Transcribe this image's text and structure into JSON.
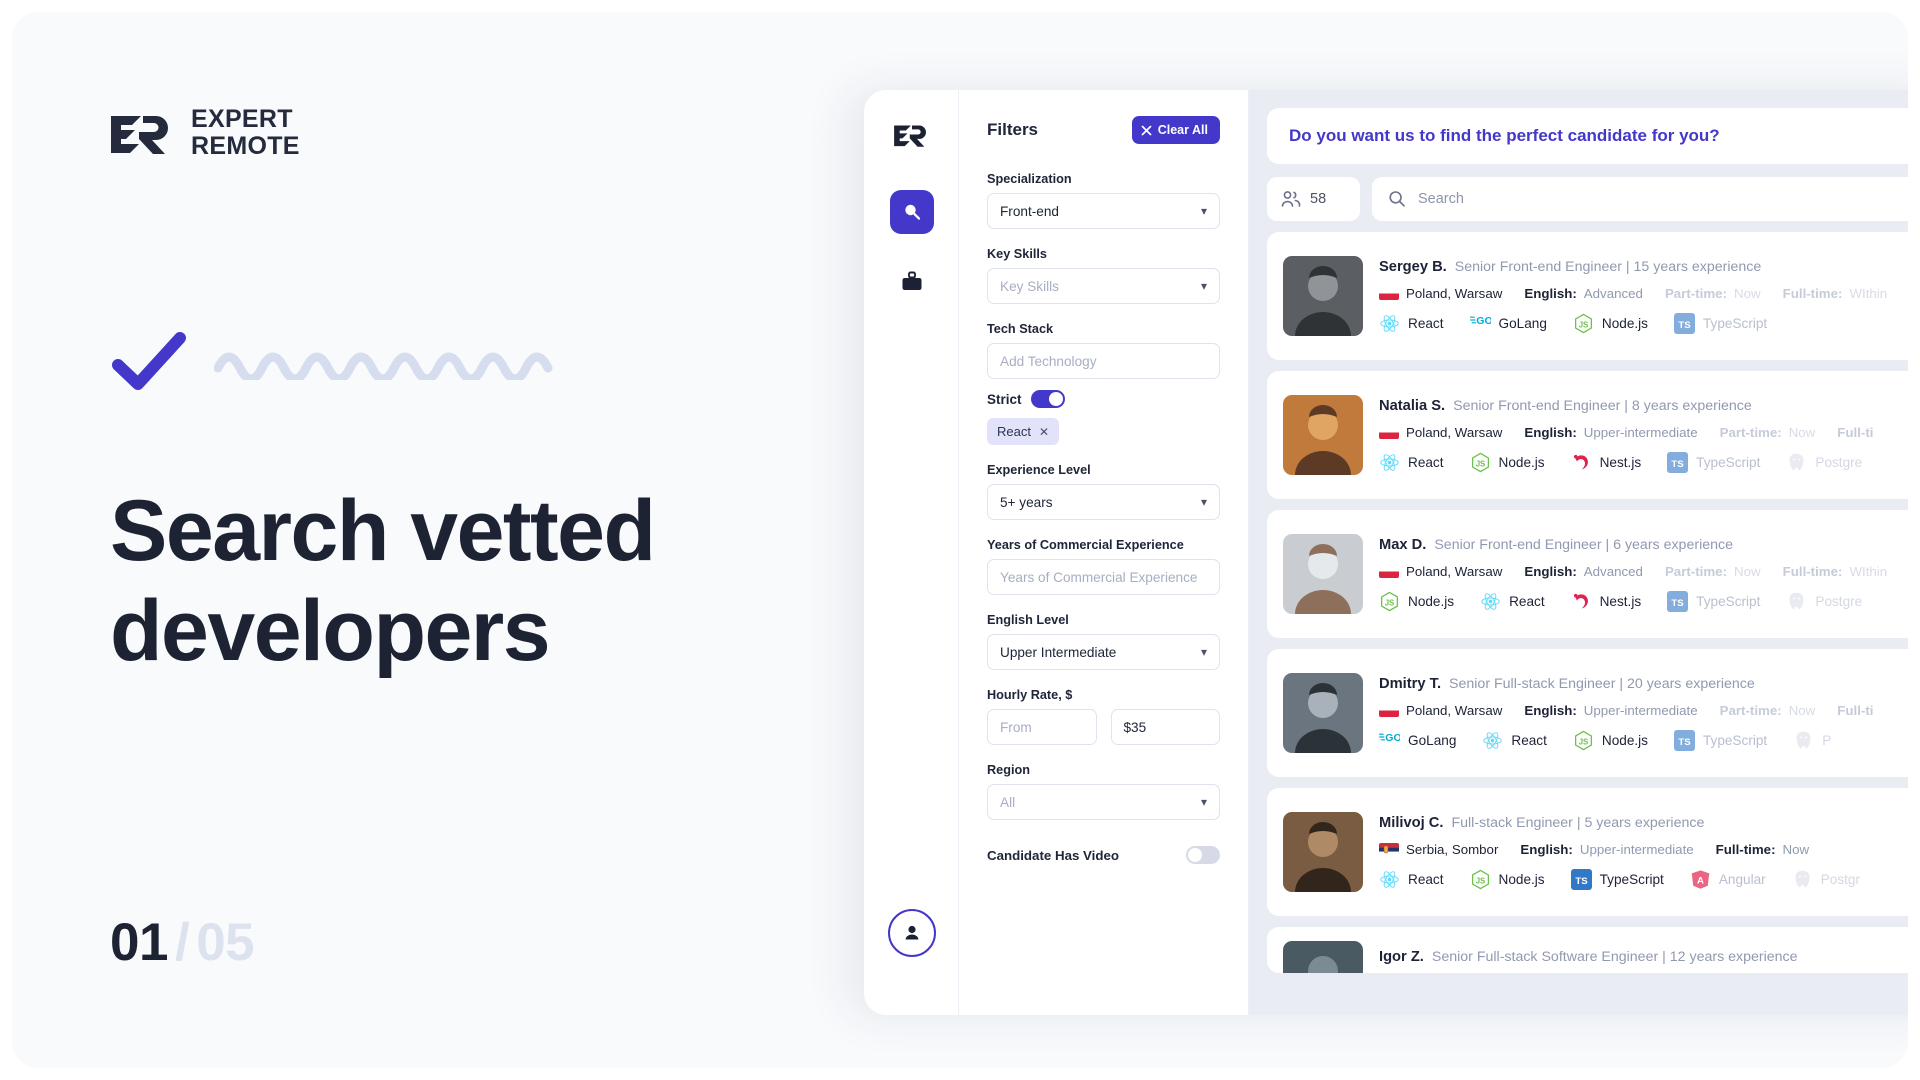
{
  "brand": {
    "logo_line1": "EXPERT",
    "logo_line2": "REMOTE"
  },
  "hero": {
    "title": "Search vetted developers",
    "pager_current": "01",
    "pager_separator": "/",
    "pager_total": "05"
  },
  "rail": {
    "search_icon": "magnifier-icon",
    "jobs_icon": "briefcase-icon",
    "avatar_icon": "user-icon"
  },
  "filters": {
    "title": "Filters",
    "clear_all": "Clear All",
    "clear_icon": "close-icon",
    "specialization": {
      "label": "Specialization",
      "value": "Front-end"
    },
    "key_skills": {
      "label": "Key Skills",
      "placeholder": "Key Skills"
    },
    "tech_stack": {
      "label": "Tech Stack",
      "placeholder": "Add Technology"
    },
    "strict": {
      "label": "Strict",
      "on": true
    },
    "tech_chip": {
      "label": "React",
      "remove": "✕"
    },
    "experience_level": {
      "label": "Experience Level",
      "value": "5+ years"
    },
    "years_commercial": {
      "label": "Years of Commercial Experience",
      "placeholder": "Years of Commercial Experience"
    },
    "english_level": {
      "label": "English Level",
      "value": "Upper Intermediate"
    },
    "hourly_rate": {
      "label": "Hourly Rate, $",
      "from_placeholder": "From",
      "to_value": "$35"
    },
    "region": {
      "label": "Region",
      "placeholder": "All"
    },
    "candidate_has_video": {
      "label": "Candidate Has Video",
      "on": false
    }
  },
  "results": {
    "promo_text": "Do you want us to find the perfect candidate for you?",
    "count": "58",
    "count_icon": "people-icon",
    "search_placeholder": "Search",
    "search_icon": "search-icon",
    "candidates": [
      {
        "name": "Sergey B.",
        "role": "Senior Front-end Engineer | 15 years experience",
        "country_flag": "poland",
        "location": "Poland, Warsaw",
        "english_label": "English:",
        "english_value": "Advanced",
        "parttime_label": "Part-time:",
        "parttime_value": "Now",
        "fulltime_label": "Full-time:",
        "fulltime_value": "WIthin",
        "tech": [
          {
            "name": "React",
            "icon": "react",
            "dim": false
          },
          {
            "name": "GoLang",
            "icon": "golang",
            "dim": false
          },
          {
            "name": "Node.js",
            "icon": "nodejs",
            "dim": false
          },
          {
            "name": "TypeScript",
            "icon": "typescript",
            "dim": true
          }
        ]
      },
      {
        "name": "Natalia S.",
        "role": "Senior Front-end Engineer | 8 years experience",
        "country_flag": "poland",
        "location": "Poland, Warsaw",
        "english_label": "English:",
        "english_value": "Upper-intermediate",
        "parttime_label": "Part-time:",
        "parttime_value": "Now",
        "fulltime_label": "Full-ti",
        "fulltime_value": "",
        "tech": [
          {
            "name": "React",
            "icon": "react",
            "dim": false
          },
          {
            "name": "Node.js",
            "icon": "nodejs",
            "dim": false
          },
          {
            "name": "Nest.js",
            "icon": "nestjs",
            "dim": false
          },
          {
            "name": "TypeScript",
            "icon": "typescript",
            "dim": true
          },
          {
            "name": "Postgre",
            "icon": "postgres",
            "dim": true
          }
        ]
      },
      {
        "name": "Max D.",
        "role": "Senior Front-end Engineer | 6 years experience",
        "country_flag": "poland",
        "location": "Poland, Warsaw",
        "english_label": "English:",
        "english_value": "Advanced",
        "parttime_label": "Part-time:",
        "parttime_value": "Now",
        "fulltime_label": "Full-time:",
        "fulltime_value": "WIthin",
        "tech": [
          {
            "name": "Node.js",
            "icon": "nodejs",
            "dim": false
          },
          {
            "name": "React",
            "icon": "react",
            "dim": false
          },
          {
            "name": "Nest.js",
            "icon": "nestjs",
            "dim": false
          },
          {
            "name": "TypeScript",
            "icon": "typescript",
            "dim": true
          },
          {
            "name": "Postgre",
            "icon": "postgres",
            "dim": true
          }
        ]
      },
      {
        "name": "Dmitry T.",
        "role": "Senior Full-stack Engineer | 20 years experience",
        "country_flag": "poland",
        "location": "Poland, Warsaw",
        "english_label": "English:",
        "english_value": "Upper-intermediate",
        "parttime_label": "Part-time:",
        "parttime_value": "Now",
        "fulltime_label": "Full-ti",
        "fulltime_value": "",
        "tech": [
          {
            "name": "GoLang",
            "icon": "golang",
            "dim": false
          },
          {
            "name": "React",
            "icon": "react",
            "dim": false
          },
          {
            "name": "Node.js",
            "icon": "nodejs",
            "dim": false
          },
          {
            "name": "TypeScript",
            "icon": "typescript",
            "dim": true
          },
          {
            "name": "P",
            "icon": "postgres",
            "dim": true
          }
        ]
      },
      {
        "name": "Milivoj C.",
        "role": "Full-stack Engineer | 5 years experience",
        "country_flag": "serbia",
        "location": "Serbia, Sombor",
        "english_label": "English:",
        "english_value": "Upper-intermediate",
        "parttime_label": "",
        "parttime_value": "",
        "fulltime_label": "Full-time:",
        "fulltime_value": "Now",
        "tech": [
          {
            "name": "React",
            "icon": "react",
            "dim": false
          },
          {
            "name": "Node.js",
            "icon": "nodejs",
            "dim": false
          },
          {
            "name": "TypeScript",
            "icon": "typescript",
            "dim": false
          },
          {
            "name": "Angular",
            "icon": "angular",
            "dim": true
          },
          {
            "name": "Postgr",
            "icon": "postgres",
            "dim": true
          }
        ]
      },
      {
        "name": "Igor Z.",
        "role": "Senior Full-stack Software Engineer | 12 years experience",
        "country_flag": "poland",
        "location": "",
        "english_label": "",
        "english_value": "",
        "parttime_label": "",
        "parttime_value": "",
        "fulltime_label": "",
        "fulltime_value": "",
        "tech": []
      }
    ]
  },
  "colors": {
    "accent": "#4338ca",
    "heading": "#1e2334",
    "muted": "#9199b0",
    "panel_bg": "#e9ecf3",
    "page_bg": "#f8fafc"
  }
}
